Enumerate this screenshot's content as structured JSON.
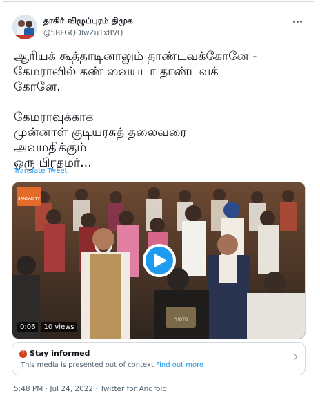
{
  "tweet": {
    "author_name": "தாகிர் விழுப்புரம் திமுக",
    "author_handle": "@5BFGQDlwZu1x8VQ",
    "more_icon": "more-dots-icon",
    "text_lines_1": [
      "ஆரியக் கூத்தாடினாலும் தாண்டவக்கோனே -",
      "கேமராவில் கண் வையடா தாண்டவக்",
      "கோனே."
    ],
    "text_lines_2": [
      "கேமராவுக்காக",
      "முன்னாள் குடியரசுத் தலைவரை",
      "அவமதிக்கும்",
      "ஒரு பிரதமர்..."
    ],
    "translate_label": "Translate Tweet"
  },
  "media": {
    "duration": "0:06",
    "views": "10 views",
    "play_icon": "play-icon",
    "channel_logo_text": "SANSAD TV",
    "watermark_text": "PHOTO"
  },
  "stay_informed": {
    "title": "Stay informed",
    "body": "This media is presented out of context",
    "link": "Find out more",
    "icon": "alert-icon",
    "chevron": "chevron-right-icon"
  },
  "footer": {
    "time": "5:48 PM",
    "date": "Jul 24, 2022",
    "separator": "·",
    "source": "Twitter for Android"
  },
  "colors": {
    "accent": "#1d9bf0",
    "alert": "#d0441e",
    "text_primary": "#0f1419",
    "text_secondary": "#536471",
    "border": "#cfd9de"
  }
}
